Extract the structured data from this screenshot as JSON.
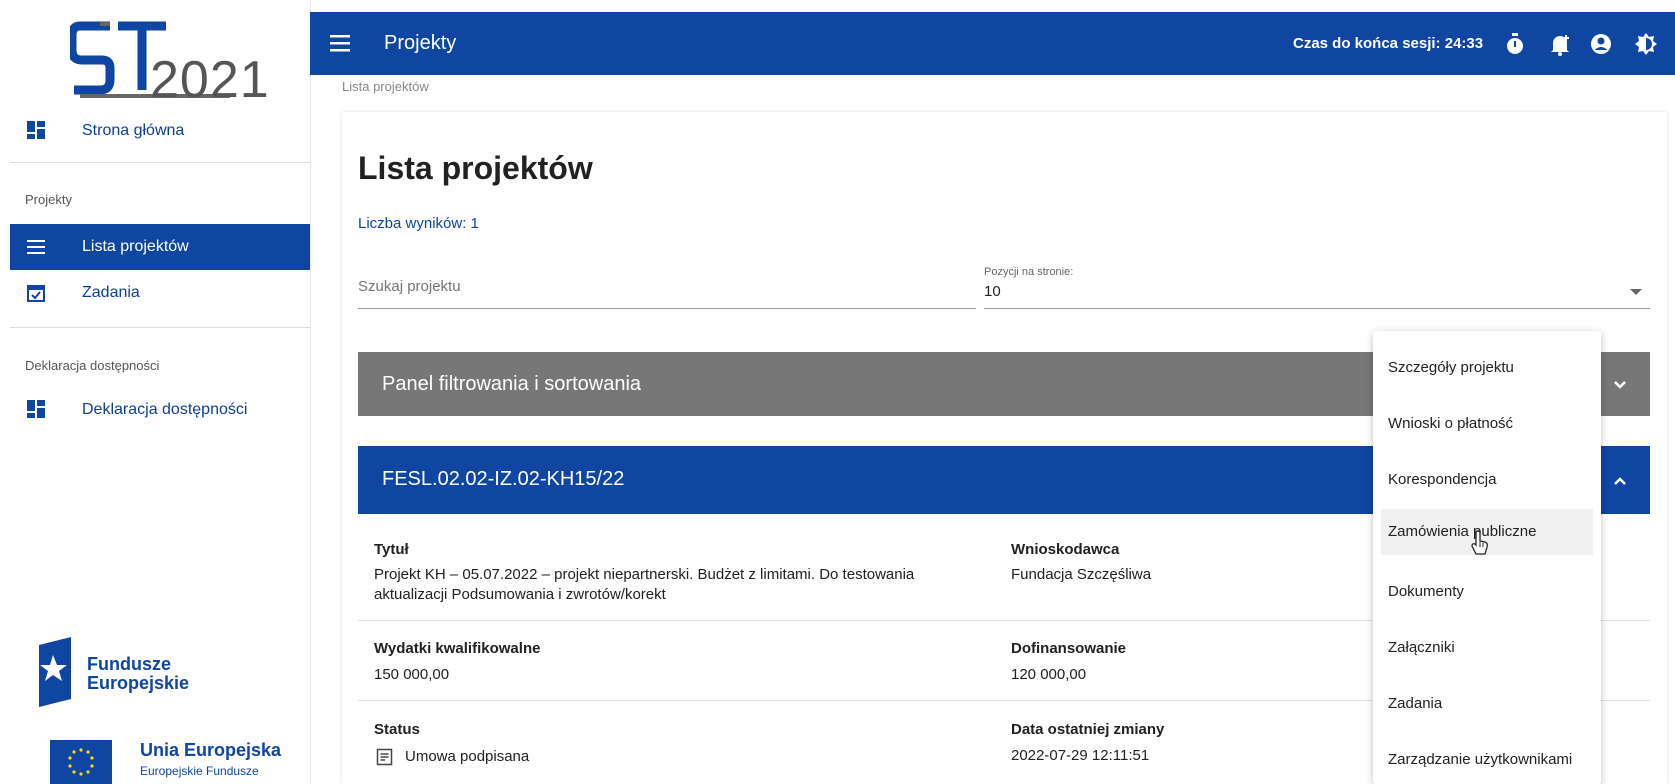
{
  "sidebar": {
    "logo_year": "2021",
    "home": "Strona główna",
    "section_projects": "Projekty",
    "project_list": "Lista projektów",
    "tasks": "Zadania",
    "section_accessibility": "Deklaracja dostępności",
    "accessibility": "Deklaracja dostępności",
    "funds_logo_line1": "Fundusze",
    "funds_logo_line2": "Europejskie",
    "eu_logo_line1": "Unia Europejska",
    "eu_logo_line2": "Europejskie Fundusze"
  },
  "topbar": {
    "title": "Projekty",
    "session": "Czas do końca sesji: 24:33",
    "bg": "#0e46a2"
  },
  "main": {
    "breadcrumb": "Lista projektów",
    "heading": "Lista projektów",
    "results": "Liczba wyników: 1",
    "search_placeholder": "Szukaj projektu",
    "per_page_label": "Pozycji na stronie:",
    "per_page_value": "10",
    "filter_panel": "Panel filtrowania i sortowania",
    "project_id": "FESL.02.02-IZ.02-KH15/22",
    "fields": {
      "title_label": "Tytuł",
      "title_value": "Projekt KH – 05.07.2022 – projekt niepartnerski. Budżet z limitami. Do testowania aktualizacji Podsumowania i zwrotów/korekt",
      "applicant_label": "Wnioskodawca",
      "applicant_value": "Fundacja Szczęśliwa",
      "eligible_label": "Wydatki kwalifikowalne",
      "eligible_value": "150 000,00",
      "funding_label": "Dofinansowanie",
      "funding_value": "120 000,00",
      "status_label": "Status",
      "status_value": "Umowa podpisana",
      "changed_label": "Data ostatniej zmiany",
      "changed_value": "2022-07-29 12:11:51"
    }
  },
  "context_menu": {
    "items": [
      "Szczegóły projektu",
      "Wnioski o płatność",
      "Korespondencja",
      "Zamówienia publiczne",
      "Dokumenty",
      "Załączniki",
      "Zadania",
      "Zarządzanie użytkownikami"
    ]
  }
}
